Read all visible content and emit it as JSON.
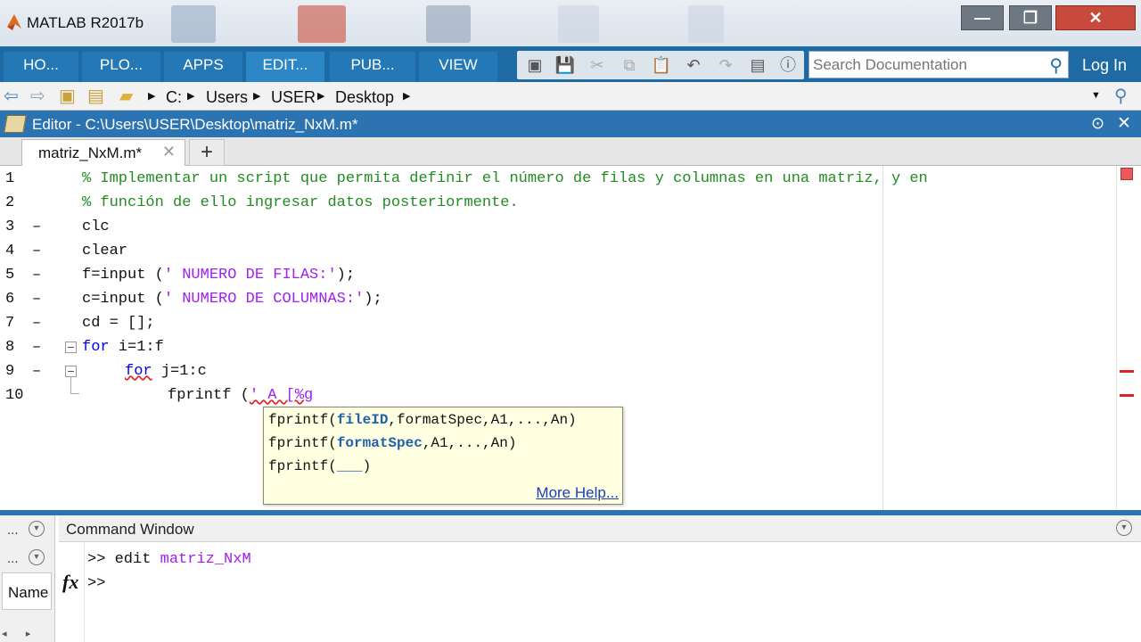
{
  "app": {
    "title": "MATLAB R2017b"
  },
  "ribbon": {
    "tabs": [
      {
        "label": "HO..."
      },
      {
        "label": "PLO..."
      },
      {
        "label": "APPS"
      },
      {
        "label": "EDIT..."
      },
      {
        "label": "PUB..."
      },
      {
        "label": "VIEW"
      }
    ],
    "selected_tab": "EDIT...",
    "search_placeholder": "Search Documentation",
    "login_label": "Log In"
  },
  "address": {
    "path": [
      "C:",
      "Users",
      "USER",
      "Desktop"
    ]
  },
  "editor": {
    "title": "Editor - C:\\Users\\USER\\Desktop\\matriz_NxM.m*",
    "tab_label": "matriz_NxM.m*",
    "add_tab": "+",
    "lines": [
      {
        "n": "1",
        "dash": "",
        "text": "% Implementar un script que permita definir el número de filas y columnas en una matriz, y en"
      },
      {
        "n": "2",
        "dash": "",
        "text": "% función de ello ingresar datos posteriormente."
      },
      {
        "n": "3",
        "dash": "–",
        "text": "clc"
      },
      {
        "n": "4",
        "dash": "–",
        "text": "clear"
      },
      {
        "n": "5",
        "dash": "–",
        "text_a": "f=input (",
        "text_str": "' NUMERO DE FILAS:'",
        "text_b": ");"
      },
      {
        "n": "6",
        "dash": "–",
        "text_a": "c=input (",
        "text_str": "' NUMERO DE COLUMNAS:'",
        "text_b": ");"
      },
      {
        "n": "7",
        "dash": "–",
        "text": "cd = [];"
      },
      {
        "n": "8",
        "dash": "–",
        "kw": "for",
        "text": " i=1:f"
      },
      {
        "n": "9",
        "dash": "–",
        "kw": "for",
        "text": " j=1:c"
      },
      {
        "n": "10",
        "dash": "",
        "text_a": "fprintf (",
        "text_str": "' A [%g"
      }
    ]
  },
  "autocomplete": {
    "signatures": [
      {
        "name": "fprintf(",
        "bold": "fileID",
        "rest": ",formatSpec,A1,...,An)"
      },
      {
        "name": "fprintf(",
        "bold": "formatSpec",
        "rest": ",A1,...,An)"
      },
      {
        "name": "fprintf(",
        "bold": "___",
        "rest": ")"
      }
    ],
    "more_help": "More Help..."
  },
  "command_window": {
    "title": "Command Window",
    "line1_prompt": ">> edit ",
    "line1_arg": "matriz_NxM",
    "line2_prompt": ">>",
    "fx": "fx"
  },
  "left_panel": {
    "dots1": "...",
    "dots2": "...",
    "name_header": "Name"
  },
  "colors": {
    "ribbon_blue": "#1d6aa5",
    "comment_green": "#228b22",
    "keyword_blue": "#0000ff",
    "string_purple": "#a020f0"
  }
}
